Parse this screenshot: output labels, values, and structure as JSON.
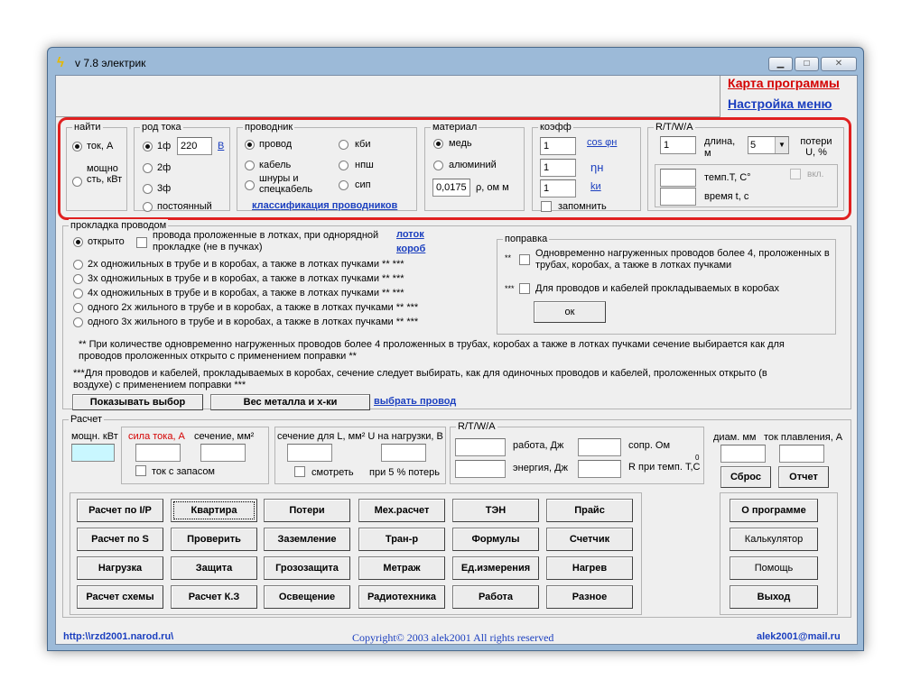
{
  "window": {
    "title": "v 7.8 электрик",
    "min": "▁",
    "max": "□",
    "close": "✕"
  },
  "top_links": {
    "map": "Карта программы",
    "settings": "Настройка меню",
    "map_color": "#d40000",
    "settings_color": "#1b3fbf"
  },
  "find": {
    "legend": "найти",
    "current": "ток, А",
    "power": "мощно сть, кВт"
  },
  "current_kind": {
    "legend": "род тока",
    "p1": "1ф",
    "voltage": "220",
    "v_link": "В",
    "p2": "2ф",
    "p3": "3ф",
    "dc": "постоянный"
  },
  "conductor": {
    "legend": "проводник",
    "wire": "провод",
    "cable": "кабель",
    "cords": "шнуры и спецкабель",
    "kbi": "кби",
    "npsh": "нпш",
    "sip": "сип",
    "classify": "классификация проводников"
  },
  "material": {
    "legend": "материал",
    "copper": "медь",
    "aluminum": "алюминий",
    "rho": "0,0175",
    "rho_label": "ρ, ом м"
  },
  "coeff": {
    "legend": "коэфф",
    "cos_value": "1",
    "cos_link": "cos φн",
    "eta_value": "1",
    "eta": "ηн",
    "k_value": "1",
    "k": "kи",
    "remember": "запомнить"
  },
  "rtwa_top": {
    "legend": "R/T/W/A",
    "value": "1",
    "length": "длина, м",
    "loss_select": "5",
    "loss": "потери U, %",
    "temp": "темп.T, C°",
    "enable": "вкл.",
    "time": "время t, с"
  },
  "laying": {
    "legend": "прокладка проводом",
    "open": "открыто",
    "trays": "провода проложенные в лотках, при однорядной прокладке (не в пучках)",
    "lotok": "лоток",
    "korob": "короб",
    "options": [
      "2х одножильных в трубе и в коробах, а также в лотках пучками ** ***",
      "3х одножильных в трубе и в коробах, а также в лотках пучками ** ***",
      "4х одножильных в трубе и в коробах, а также в лотках пучками ** ***",
      "одного 2х жильного в трубе и в коробах, а также в лотках пучками ** ***",
      "одного 3х жильного в трубе и в коробах, а также в лотках пучками ** ***"
    ],
    "note1": "** При количестве одновременно нагруженных проводов более 4 проложенных в трубах, коробах а также в лотках пучками сечение выбирается как для проводов проложенных открыто с применением поправки **",
    "note2": "***Для проводов и кабелей, прокладываемых в коробах, сечение следует выбирать, как для одиночных проводов и кабелей, проложенных открыто (в воздухе) с применением поправки ***",
    "show_btn": "Показывать выбор",
    "metal_btn": "Вес металла и х-ки",
    "choose_link": "выбрать провод"
  },
  "correction": {
    "legend": "поправка",
    "m1": "**",
    "t1": "Одновременно нагруженных проводов более 4, проложенных в трубах, коробах, а также в лотках пучками",
    "m2": "***",
    "t2": "Для проводов и кабелей прокладываемых в коробах",
    "ok": "ок"
  },
  "calc": {
    "legend": "Расчет",
    "power": "мощн. кВт",
    "current": "сила тока, А",
    "current_color": "#d40000",
    "section": "сечение, мм²",
    "reserve": "ток с запасом",
    "section_lu": "сечение для L, мм² U на нагрузки, В",
    "watch": "смотреть",
    "at5": "при 5 % потерь",
    "rtwa": "R/T/W/A",
    "work": "работа, Дж",
    "energy": "энергия, Дж",
    "resist": "сопр. Ом",
    "r_temp": "R при темп. T,C",
    "r_temp_sup": "0",
    "diam": "диам. мм",
    "melt": "ток плавления, А",
    "reset": "Сброс",
    "report": "Отчет"
  },
  "grid": [
    [
      "Расчет по I/P",
      "Квартира",
      "Потери",
      "Мех.расчет",
      "ТЭН",
      "Прайс"
    ],
    [
      "Расчет по S",
      "Проверить",
      "Заземление",
      "Тран-р",
      "Формулы",
      "Счетчик"
    ],
    [
      "Нагрузка",
      "Защита",
      "Грозозащита",
      "Метраж",
      "Ед.измерения",
      "Нагрев"
    ],
    [
      "Расчет схемы",
      "Расчет К.З",
      "Освещение",
      "Радиотехника",
      "Работа",
      "Разное"
    ]
  ],
  "side_buttons": {
    "about": "О программе",
    "calculator": "Калькулятор",
    "help": "Помощь",
    "exit": "Выход"
  },
  "footer": {
    "url": "http:\\\\rzd2001.narod.ru\\",
    "copyright": "Copyright© 2003 alek2001 All rights reserved",
    "email": "alek2001@mail.ru"
  },
  "highlight_color": "#e02020"
}
